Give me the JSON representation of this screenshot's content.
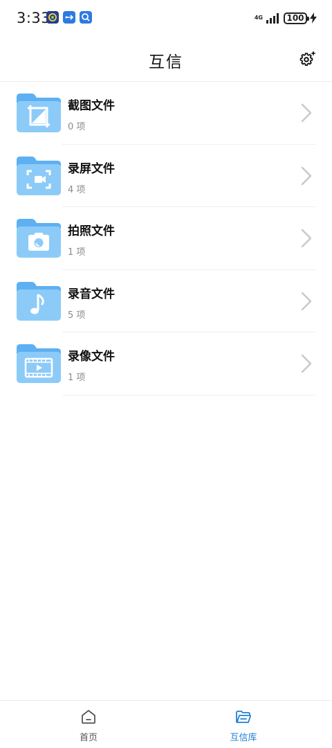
{
  "status_bar": {
    "time": "3:33",
    "network": "4G",
    "battery": "100"
  },
  "header": {
    "title": "互信",
    "settings_icon": "gear-sparkle-icon"
  },
  "folders": [
    {
      "name": "截图文件",
      "count": "0 项",
      "icon": "crop-icon"
    },
    {
      "name": "录屏文件",
      "count": "4 项",
      "icon": "screen-record-icon"
    },
    {
      "name": "拍照文件",
      "count": "1 项",
      "icon": "camera-icon"
    },
    {
      "name": "录音文件",
      "count": "5 项",
      "icon": "music-note-icon"
    },
    {
      "name": "录像文件",
      "count": "1 项",
      "icon": "video-icon"
    }
  ],
  "bottom_nav": {
    "tabs": [
      {
        "label": "首页",
        "icon": "home-icon",
        "active": false
      },
      {
        "label": "互信库",
        "icon": "folder-open-icon",
        "active": true
      }
    ]
  },
  "colors": {
    "folder_light": "#8ccbf8",
    "folder_dark": "#5db0f2",
    "accent": "#1e7fd6"
  }
}
